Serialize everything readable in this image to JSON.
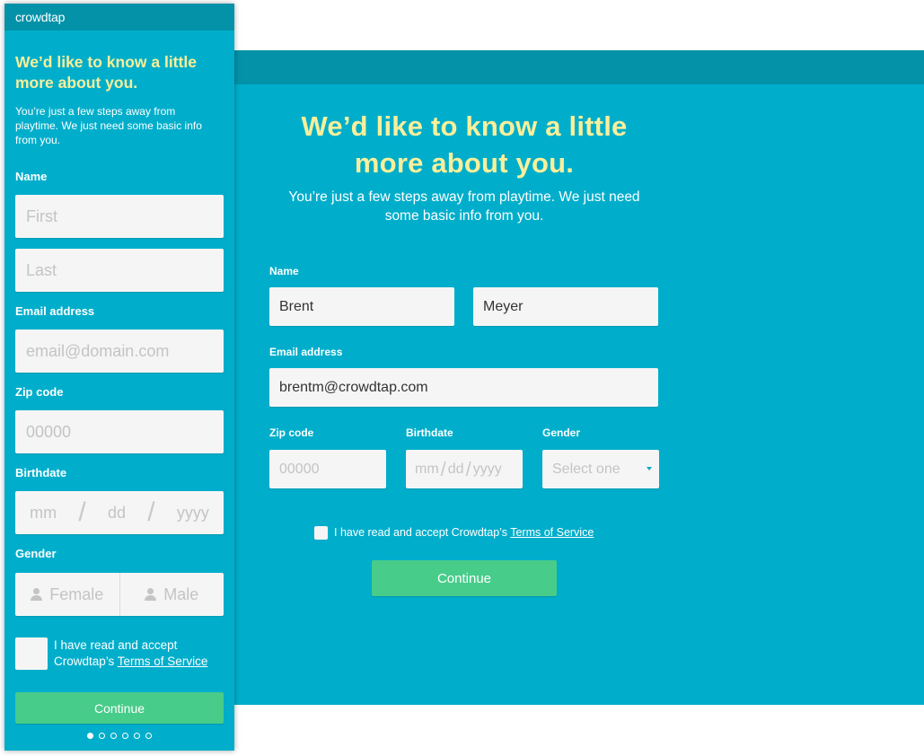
{
  "desktop": {
    "title_line1": "We’d like to know a little",
    "title_line2": "more about you.",
    "subtitle_line1": "You’re just a few steps away from playtime. We just need",
    "subtitle_line2": "some basic info from you.",
    "name_label": "Name",
    "first_name_value": "Brent",
    "last_name_value": "Meyer",
    "email_label": "Email address",
    "email_value": "brentm@crowdtap.com",
    "zip_label": "Zip code",
    "zip_placeholder": "00000",
    "birthdate_label": "Birthdate",
    "birth_mm": "mm",
    "birth_dd": "dd",
    "birth_yyyy": "yyyy",
    "birth_sep": "/",
    "gender_label": "Gender",
    "gender_placeholder": "Select one",
    "terms_prefix": "I have read and accept Crowdtap’s ",
    "terms_link": "Terms of Service",
    "continue_label": "Continue"
  },
  "mobile": {
    "brand": "crowdtap",
    "title_line1": "We’d like to know a little",
    "title_line2": "more about you.",
    "subtitle_line1": "You’re just a few steps away from",
    "subtitle_line2": "playtime. We just need some basic info",
    "subtitle_line3": "from you.",
    "name_label": "Name",
    "first_placeholder": "First",
    "last_placeholder": "Last",
    "email_label": "Email address",
    "email_placeholder": "email@domain.com",
    "zip_label": "Zip code",
    "zip_placeholder": "00000",
    "birthdate_label": "Birthdate",
    "birth_mm": "mm",
    "birth_dd": "dd",
    "birth_yyyy": "yyyy",
    "birth_sep": "/",
    "gender_label": "Gender",
    "gender_female": "Female",
    "gender_male": "Male",
    "terms_line1": "I have read and accept",
    "terms_prefix": "Crowdtap’s ",
    "terms_link": "Terms of Service",
    "continue_label": "Continue",
    "page_indicator": {
      "total": 6,
      "active": 1
    }
  },
  "colors": {
    "background": "#00aecb",
    "header": "#0392a8",
    "title": "#f9ef9a",
    "button": "#48cc8a",
    "input": "#f5f5f5"
  },
  "icons": [
    "person-icon",
    "caret-down-icon"
  ]
}
